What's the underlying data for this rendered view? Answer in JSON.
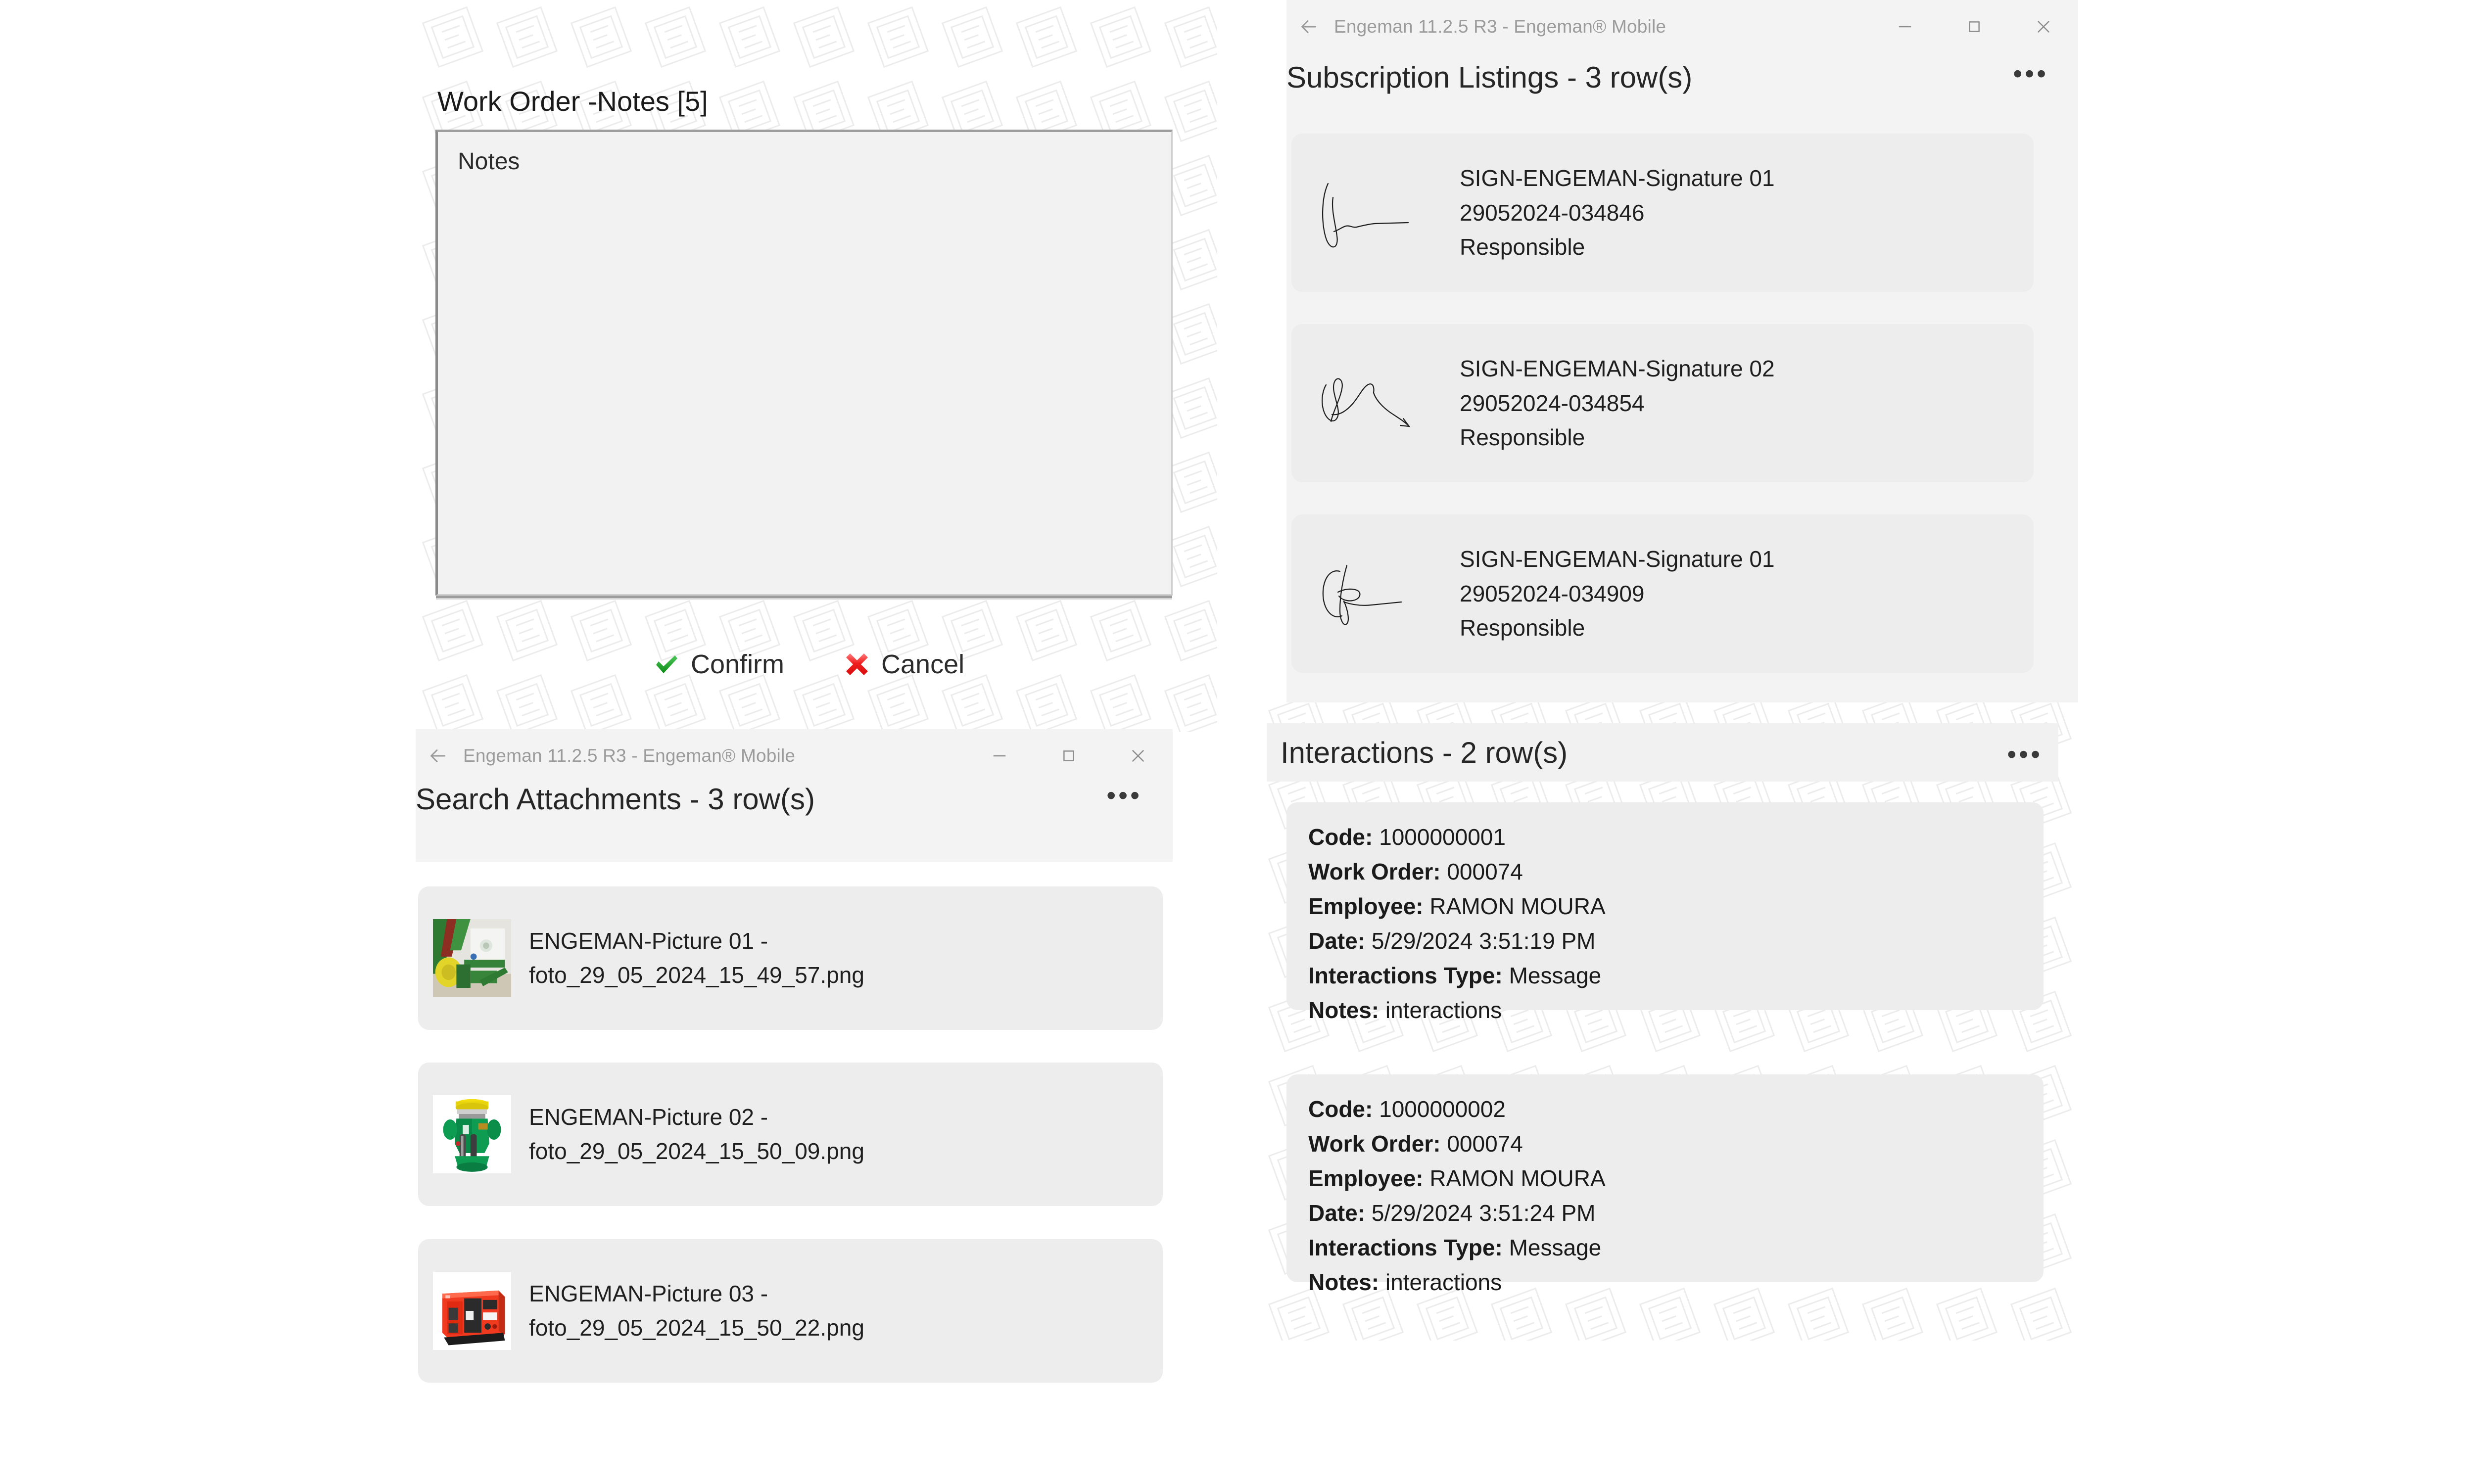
{
  "notes_dialog": {
    "title": "Work Order -Notes [5]",
    "field_placeholder": "Notes",
    "field_value": "",
    "confirm_label": "Confirm",
    "cancel_label": "Cancel",
    "confirm_icon": "check-mark-icon",
    "cancel_icon": "red-x-icon",
    "confirm_color": "#1f9d27",
    "cancel_color": "#ef2b2b"
  },
  "subscription_window": {
    "titlebar": {
      "back_icon": "back-arrow-icon",
      "title": "Engeman 11.2.5 R3 - Engeman® Mobile",
      "minimize_icon": "minimize-icon",
      "maximize_icon": "maximize-icon",
      "close_icon": "close-icon"
    },
    "section_title": "Subscription Listings - 3 row(s)",
    "overflow_icon": "ellipsis-icon",
    "items": [
      {
        "signature_icon": "signature-scribble-icon",
        "name": "SIGN-ENGEMAN-Signature 01",
        "code": "29052024-034846",
        "role": "Responsible"
      },
      {
        "signature_icon": "signature-scribble-icon",
        "name": "SIGN-ENGEMAN-Signature 02",
        "code": "29052024-034854",
        "role": "Responsible"
      },
      {
        "signature_icon": "signature-scribble-icon",
        "name": "SIGN-ENGEMAN-Signature 01",
        "code": "29052024-034909",
        "role": "Responsible"
      }
    ]
  },
  "interactions_panel": {
    "section_title": "Interactions - 2 row(s)",
    "overflow_icon": "ellipsis-icon",
    "labels": {
      "code": "Code:",
      "work_order": "Work Order:",
      "employee": "Employee:",
      "date": "Date:",
      "type": "Interactions Type:",
      "notes": "Notes:"
    },
    "rows": [
      {
        "code": "1000000001",
        "work_order": "000074",
        "employee": "RAMON MOURA",
        "date": "5/29/2024 3:51:19 PM",
        "type": "Message",
        "notes": "interactions"
      },
      {
        "code": "1000000002",
        "work_order": "000074",
        "employee": "RAMON MOURA",
        "date": "5/29/2024 3:51:24 PM",
        "type": "Message",
        "notes": "interactions"
      }
    ]
  },
  "attachments_window": {
    "titlebar": {
      "back_icon": "back-arrow-icon",
      "title": "Engeman 11.2.5 R3 - Engeman® Mobile",
      "minimize_icon": "minimize-icon",
      "maximize_icon": "maximize-icon",
      "close_icon": "close-icon"
    },
    "section_title": "Search Attachments - 3 row(s)",
    "overflow_icon": "ellipsis-icon",
    "items": [
      {
        "thumbnail_icon": "green-harvester-photo",
        "line1": "ENGEMAN-Picture 01 -",
        "line2": "foto_29_05_2024_15_49_57.png"
      },
      {
        "thumbnail_icon": "green-pump-photo",
        "line1": "ENGEMAN-Picture 02 -",
        "line2": "foto_29_05_2024_15_50_09.png"
      },
      {
        "thumbnail_icon": "red-generator-photo",
        "line1": "ENGEMAN-Picture 03 -",
        "line2": "foto_29_05_2024_15_50_22.png"
      }
    ]
  }
}
